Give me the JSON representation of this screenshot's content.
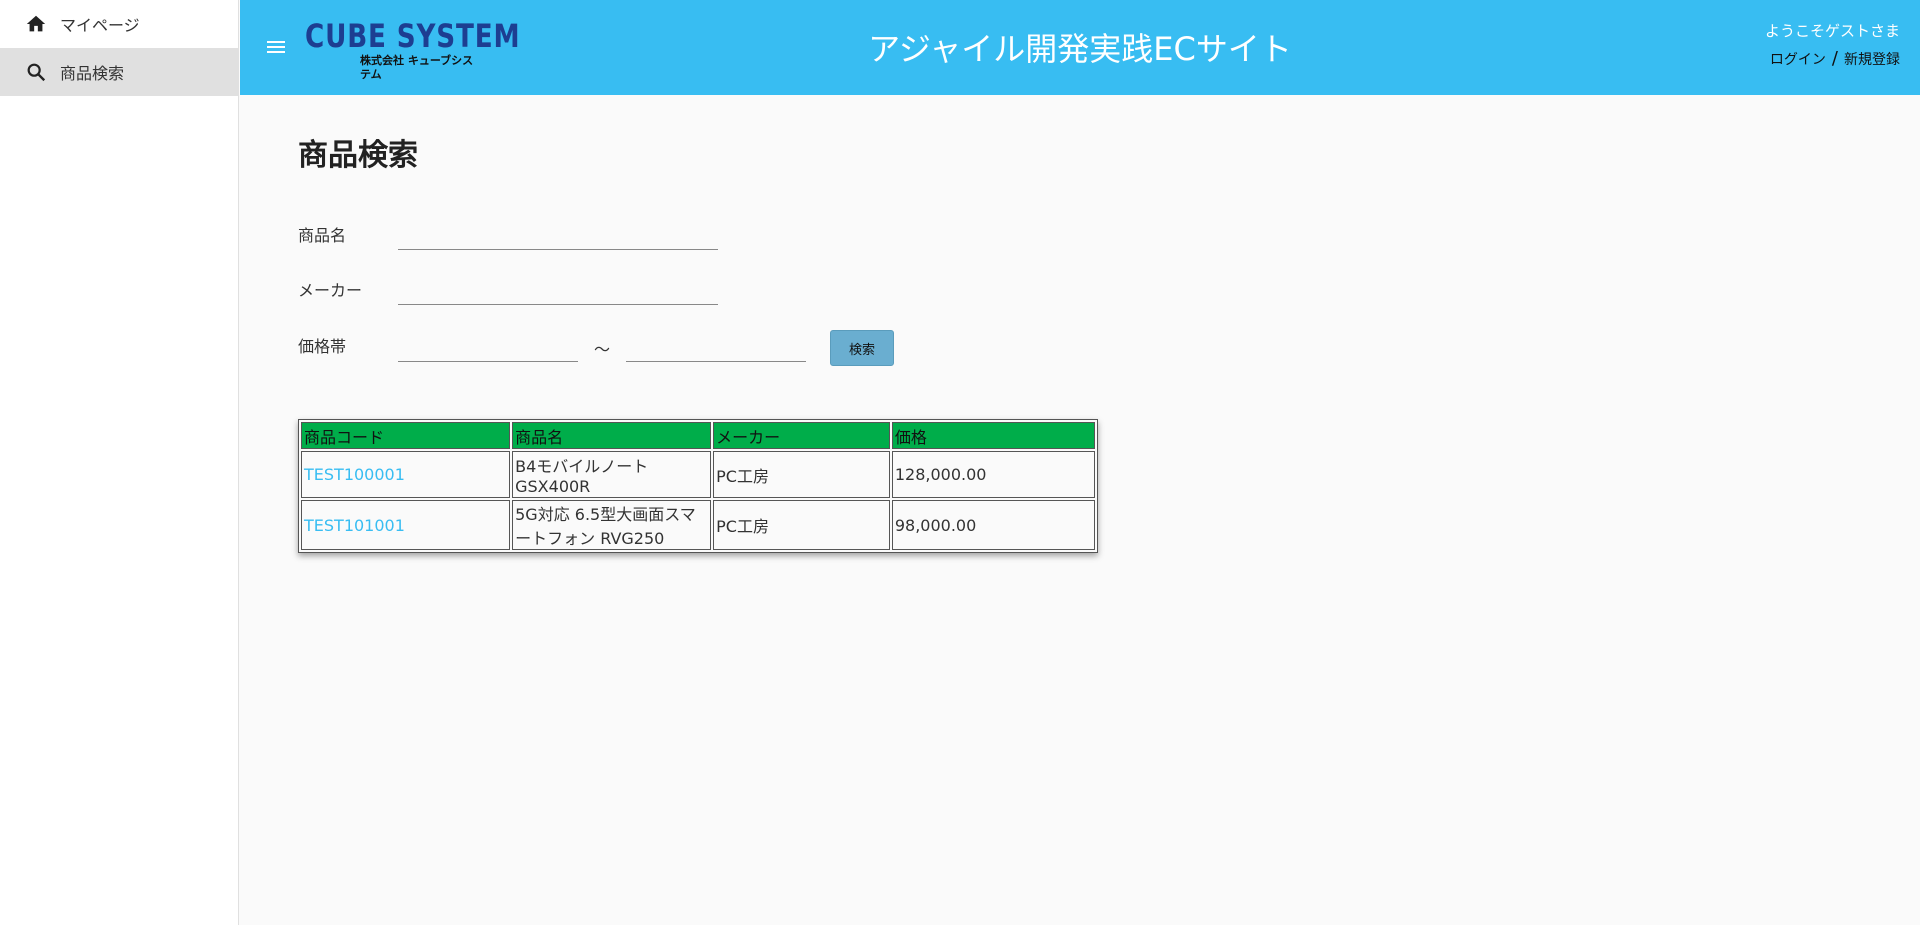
{
  "sidebar": {
    "items": [
      {
        "label": "マイページ",
        "icon": "home-icon"
      },
      {
        "label": "商品検索",
        "icon": "search-icon",
        "active": true
      }
    ]
  },
  "header": {
    "logo_main": "CUBE SYSTEM",
    "logo_sub": "株式会社 キューブシステム",
    "title": "アジャイル開発実践ECサイト",
    "welcome": "ようこそゲストさま",
    "login": "ログイン",
    "separator": "/",
    "register": "新規登録",
    "background_color": "#38bdf2"
  },
  "page": {
    "title": "商品検索"
  },
  "form": {
    "product_name_label": "商品名",
    "product_name_value": "",
    "maker_label": "メーカー",
    "maker_value": "",
    "price_label": "価格帯",
    "price_min_value": "",
    "price_max_value": "",
    "tilde": "～",
    "search_button": "検索"
  },
  "table": {
    "headers": [
      "商品コード",
      "商品名",
      "メーカー",
      "価格"
    ],
    "header_color": "#00ad4a",
    "rows": [
      [
        "TEST100001",
        "B4モバイルノート GSX400R",
        "PC工房",
        "128,000.00"
      ],
      [
        "TEST101001",
        "5G対応 6.5型大画面スマートフォン RVG250",
        "PC工房",
        "98,000.00"
      ]
    ]
  }
}
